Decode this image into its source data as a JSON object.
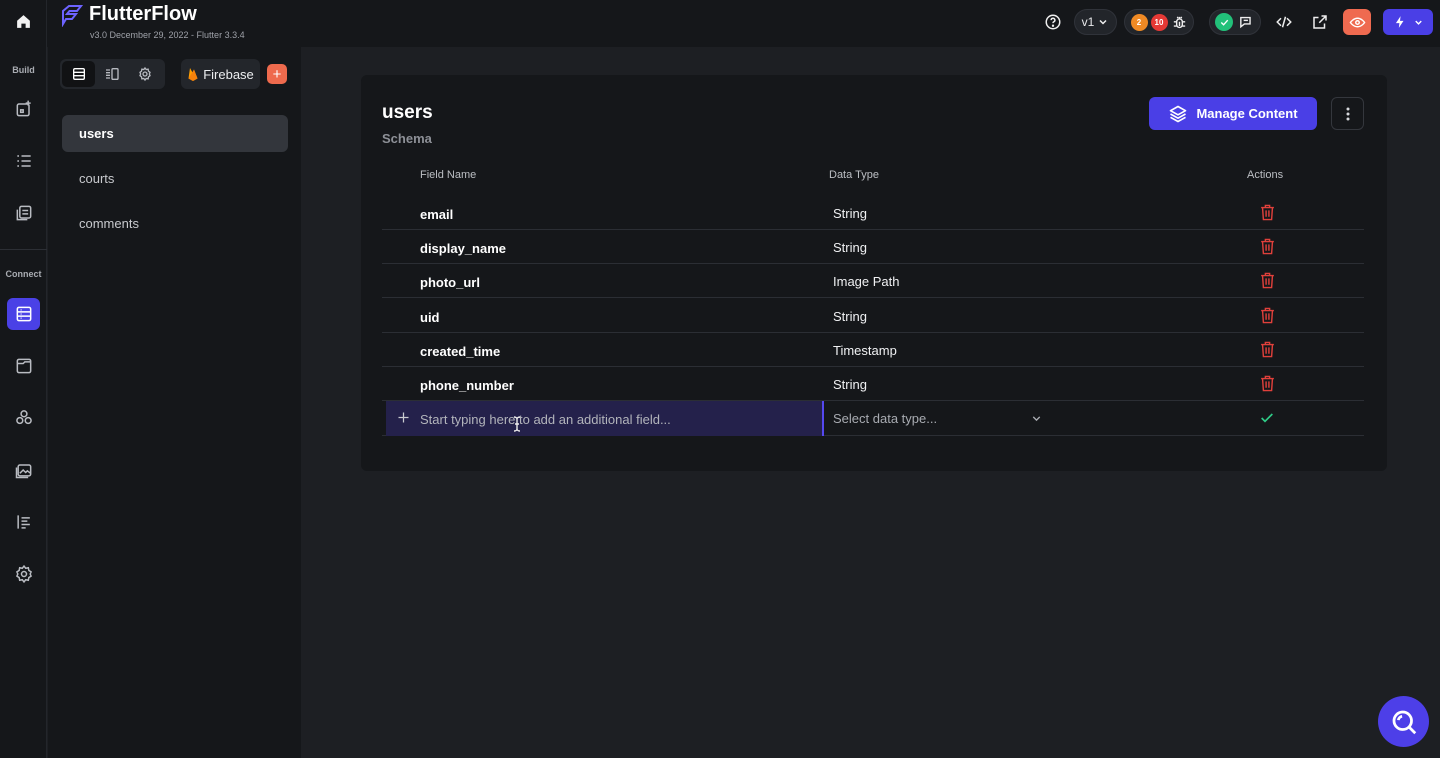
{
  "app": {
    "brand": "FlutterFlow",
    "version": "v3.0 December 29, 2022 - Flutter 3.3.4"
  },
  "rail": {
    "build_label": "Build",
    "connect_label": "Connect",
    "items": [
      {
        "name": "home-icon"
      },
      {
        "name": "add-page-icon"
      },
      {
        "name": "widget-tree-icon"
      },
      {
        "name": "storyboard-icon"
      },
      {
        "name": "firestore-icon",
        "active": true
      },
      {
        "name": "app-state-icon"
      },
      {
        "name": "integrations-icon"
      },
      {
        "name": "media-assets-icon"
      },
      {
        "name": "theme-icon"
      },
      {
        "name": "settings-icon"
      }
    ]
  },
  "topbar": {
    "version_selector": "v1",
    "warnings_count": "2",
    "errors_count": "10",
    "colors": {
      "warning": "#f08a24",
      "error": "#e53935",
      "ok": "#22c17a",
      "preview": "#ef6a50",
      "run": "#4a3fe6"
    }
  },
  "sidebar": {
    "firebase_label": "Firebase",
    "add_label": "+",
    "collections": [
      {
        "label": "users",
        "active": true
      },
      {
        "label": "courts",
        "active": false
      },
      {
        "label": "comments",
        "active": false
      }
    ]
  },
  "schema": {
    "title": "users",
    "subtitle": "Schema",
    "manage_button": "Manage Content",
    "columns": {
      "field": "Field Name",
      "type": "Data Type",
      "actions": "Actions"
    },
    "fields": [
      {
        "name": "email",
        "type": "String"
      },
      {
        "name": "display_name",
        "type": "String"
      },
      {
        "name": "photo_url",
        "type": "Image Path"
      },
      {
        "name": "uid",
        "type": "String"
      },
      {
        "name": "created_time",
        "type": "Timestamp"
      },
      {
        "name": "phone_number",
        "type": "String"
      }
    ],
    "new_field_placeholder": "Start typing here to add an additional field...",
    "type_placeholder": "Select data type..."
  }
}
